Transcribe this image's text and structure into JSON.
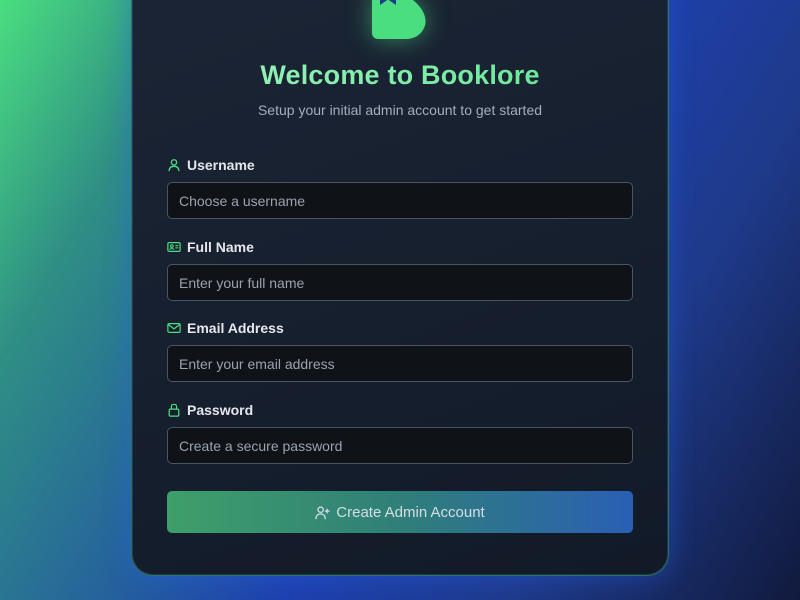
{
  "header": {
    "title": "Welcome to Booklore",
    "subtitle": "Setup your initial admin account to get started",
    "logo_icon": "booklore-logo-icon"
  },
  "form": {
    "fields": [
      {
        "label": "Username",
        "placeholder": "Choose a username",
        "value": "",
        "icon": "user-icon"
      },
      {
        "label": "Full Name",
        "placeholder": "Enter your full name",
        "value": "",
        "icon": "id-card-icon"
      },
      {
        "label": "Email Address",
        "placeholder": "Enter your email address",
        "value": "",
        "icon": "envelope-icon"
      },
      {
        "label": "Password",
        "placeholder": "Create a secure password",
        "value": "",
        "icon": "lock-icon"
      }
    ],
    "submit_label": "Create Admin Account",
    "submit_icon": "user-plus-icon"
  },
  "colors": {
    "accent_green": "#4ade80",
    "accent_blue": "#2563eb",
    "card_bg": "#161f2e",
    "input_bg": "#0f1217"
  }
}
